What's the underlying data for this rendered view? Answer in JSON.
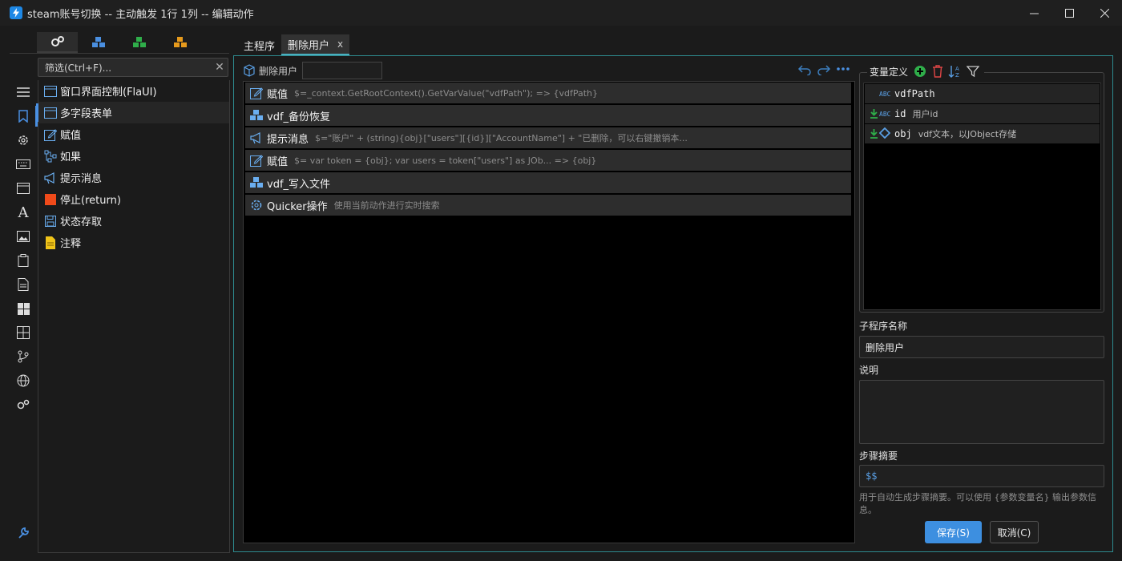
{
  "window": {
    "title": "steam账号切换 -- 主动触发 1行 1列 -- 编辑动作"
  },
  "category_tabs": [
    {
      "icon": "gears-icon"
    },
    {
      "icon": "blue-cubes-icon"
    },
    {
      "icon": "green-cubes-icon"
    },
    {
      "icon": "orange-cubes-icon"
    }
  ],
  "filter": {
    "placeholder": "筛选(Ctrl+F)..."
  },
  "action_tree": [
    {
      "label": "窗口界面控制(FlaUI)",
      "icon": "window-icon"
    },
    {
      "label": "多字段表单",
      "icon": "form-icon",
      "selected": true
    },
    {
      "label": "赋值",
      "icon": "edit-icon"
    },
    {
      "label": "如果",
      "icon": "branch-icon"
    },
    {
      "label": "提示消息",
      "icon": "megaphone-icon"
    },
    {
      "label": "停止(return)",
      "icon": "stop-icon"
    },
    {
      "label": "状态存取",
      "icon": "save-icon"
    },
    {
      "label": "注释",
      "icon": "note-icon"
    }
  ],
  "editor_tabs": [
    {
      "label": "主程序",
      "active": false
    },
    {
      "label": "删除用户",
      "active": true,
      "close": "x"
    }
  ],
  "flow": {
    "subprogram_label": "删除用户",
    "steps": [
      {
        "title": "赋值",
        "desc": "$=_context.GetRootContext().GetVarValue(\"vdfPath\"); => {vdfPath}",
        "icon": "edit-icon"
      },
      {
        "title": "vdf_备份恢复",
        "desc": "",
        "icon": "cubes-icon"
      },
      {
        "title": "提示消息",
        "desc": "$=\"账户\" + (string){obj}[\"users\"][{id}][\"AccountName\"] + \"已删除，可以右键撤销本...",
        "icon": "megaphone-icon"
      },
      {
        "title": "赋值",
        "desc": "$=  var token = {obj};  var users = token[\"users\"] as JOb... => {obj}",
        "icon": "edit-icon"
      },
      {
        "title": "vdf_写入文件",
        "desc": "",
        "icon": "cubes-icon"
      },
      {
        "title": "Quicker操作",
        "desc": "使用当前动作进行实时搜索",
        "icon": "gear-icon"
      }
    ]
  },
  "variables": {
    "label": "变量定义",
    "items": [
      {
        "name": "vdfPath",
        "type": "ABC",
        "desc": "",
        "input": false
      },
      {
        "name": "id",
        "type": "ABC",
        "desc": "用户id",
        "input": true
      },
      {
        "name": "obj",
        "type": "diamond",
        "desc": "vdf文本，以JObject存储",
        "input": true
      }
    ]
  },
  "subprogram": {
    "name_label": "子程序名称",
    "name_value": "删除用户",
    "desc_label": "说明",
    "summary_label": "步骤摘要",
    "summary_value": "$$",
    "hint": "用于自动生成步骤摘要。可以使用 {参数变量名} 输出参数信息。"
  },
  "buttons": {
    "save": "保存(S)",
    "cancel": "取消(C)"
  },
  "colors": {
    "accent": "#3d8fe0",
    "border_teal": "#2e8b8f"
  }
}
